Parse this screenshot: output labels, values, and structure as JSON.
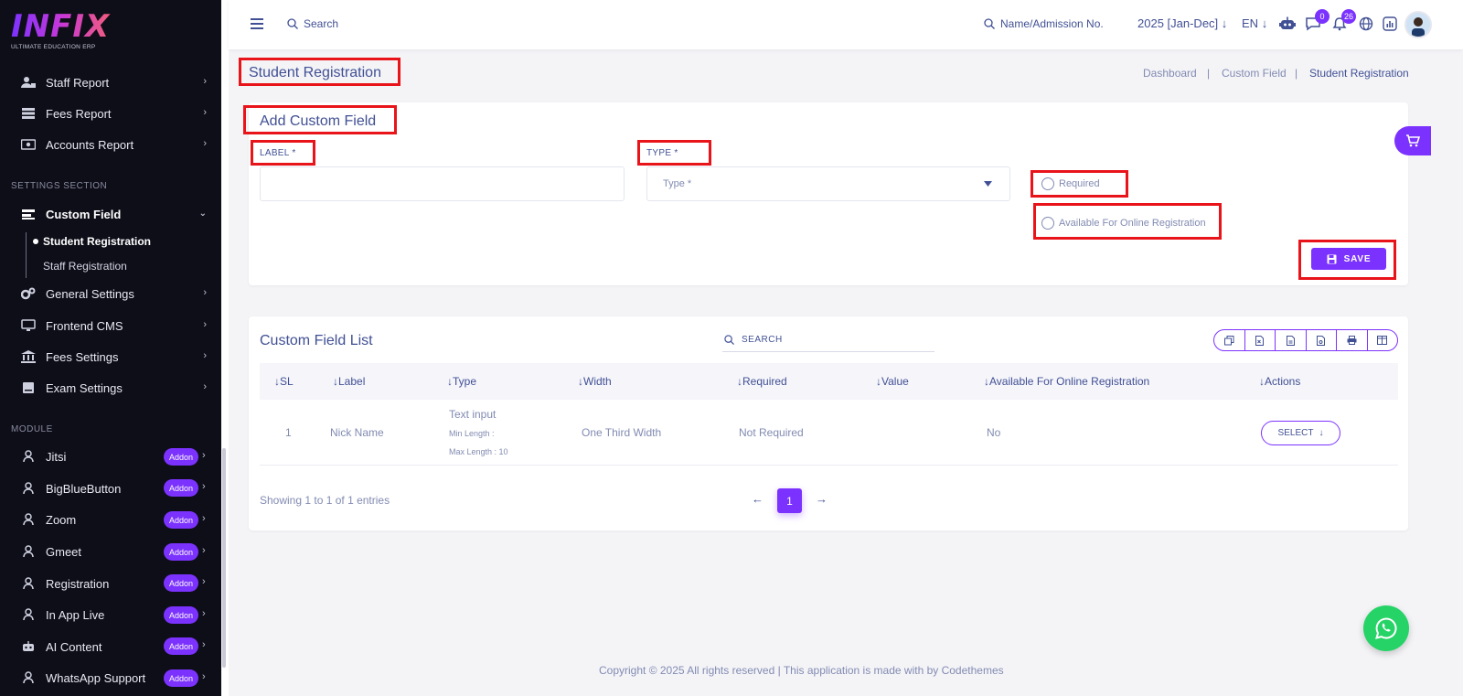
{
  "brand": {
    "logo_text": "INFIX",
    "logo_subtitle": "ULTIMATE EDUCATION ERP"
  },
  "sidebar": {
    "report_items": [
      {
        "label": "Staff Report",
        "icon": "staff-icon"
      },
      {
        "label": "Fees Report",
        "icon": "fees-icon"
      },
      {
        "label": "Accounts Report",
        "icon": "accounts-icon"
      }
    ],
    "settings_section_label": "SETTINGS SECTION",
    "custom_field": {
      "label": "Custom Field",
      "children": [
        {
          "label": "Student Registration",
          "active": true
        },
        {
          "label": "Staff Registration",
          "active": false
        }
      ]
    },
    "settings_items": [
      {
        "label": "General Settings"
      },
      {
        "label": "Frontend CMS"
      },
      {
        "label": "Fees Settings"
      },
      {
        "label": "Exam Settings"
      }
    ],
    "module_section_label": "MODULE",
    "modules": [
      {
        "label": "Jitsi",
        "badge": "Addon"
      },
      {
        "label": "BigBlueButton",
        "badge": "Addon"
      },
      {
        "label": "Zoom",
        "badge": "Addon"
      },
      {
        "label": "Gmeet",
        "badge": "Addon"
      },
      {
        "label": "Registration",
        "badge": "Addon"
      },
      {
        "label": "In App Live",
        "badge": "Addon"
      },
      {
        "label": "AI Content",
        "badge": "Addon"
      },
      {
        "label": "WhatsApp Support",
        "badge": "Addon"
      }
    ]
  },
  "topbar": {
    "search_placeholder": "Search",
    "student_search_placeholder": "Name/Admission No.",
    "academic_year": "2025 [Jan-Dec]",
    "language": "EN",
    "chat_badge": "0",
    "notification_badge": "26"
  },
  "page": {
    "title": "Student Registration",
    "breadcrumb": [
      "Dashboard",
      "Custom Field",
      "Student Registration"
    ]
  },
  "form": {
    "title": "Add Custom Field",
    "label_field_label": "LABEL *",
    "label_value": "",
    "type_field_label": "TYPE *",
    "type_placeholder": "Type *",
    "required_label": "Required",
    "online_label": "Available For Online Registration",
    "save_label": "SAVE"
  },
  "list": {
    "title": "Custom Field List",
    "search_placeholder": "SEARCH",
    "columns": [
      "SL",
      "Label",
      "Type",
      "Width",
      "Required",
      "Value",
      "Available For Online Registration",
      "Actions"
    ],
    "rows": [
      {
        "sl": "1",
        "label": "Nick Name",
        "type": "Text input",
        "min_length": "Min Length :",
        "max_length": "Max Length : 10",
        "width": "One Third Width",
        "required": "Not Required",
        "value": "",
        "online": "No",
        "action": "SELECT"
      }
    ],
    "showing": "Showing 1 to 1 of 1 entries",
    "current_page": "1"
  },
  "footer": "Copyright © 2025 All rights reserved | This application is made with by Codethemes",
  "colors": {
    "accent": "#7c32ff",
    "text": "#415094",
    "muted": "#828bb2",
    "highlight": "#e8141a",
    "whatsapp": "#25d366"
  }
}
